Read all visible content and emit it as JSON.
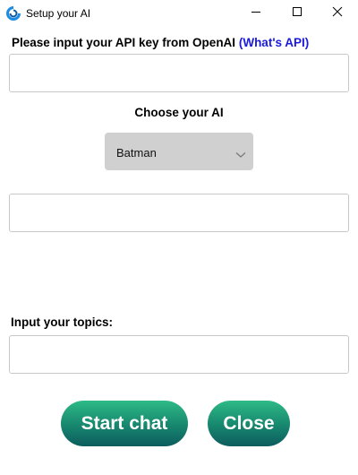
{
  "window": {
    "title": "Setup your AI",
    "icon": "app-logo-icon",
    "controls": [
      "minimize-icon",
      "maximize-icon",
      "close-icon"
    ]
  },
  "api": {
    "label": "Please input your API key from OpenAI",
    "link": "(What's API)",
    "value": "",
    "link_color": "#1a1adb"
  },
  "choose": {
    "label": "Choose your AI",
    "selected": "Batman"
  },
  "extra_field": {
    "value": ""
  },
  "topics": {
    "label": "Input your topics:",
    "value": ""
  },
  "buttons": {
    "start": "Start chat",
    "close": "Close",
    "gradient_top": "#2dba86",
    "gradient_bottom": "#0c5c5e"
  }
}
